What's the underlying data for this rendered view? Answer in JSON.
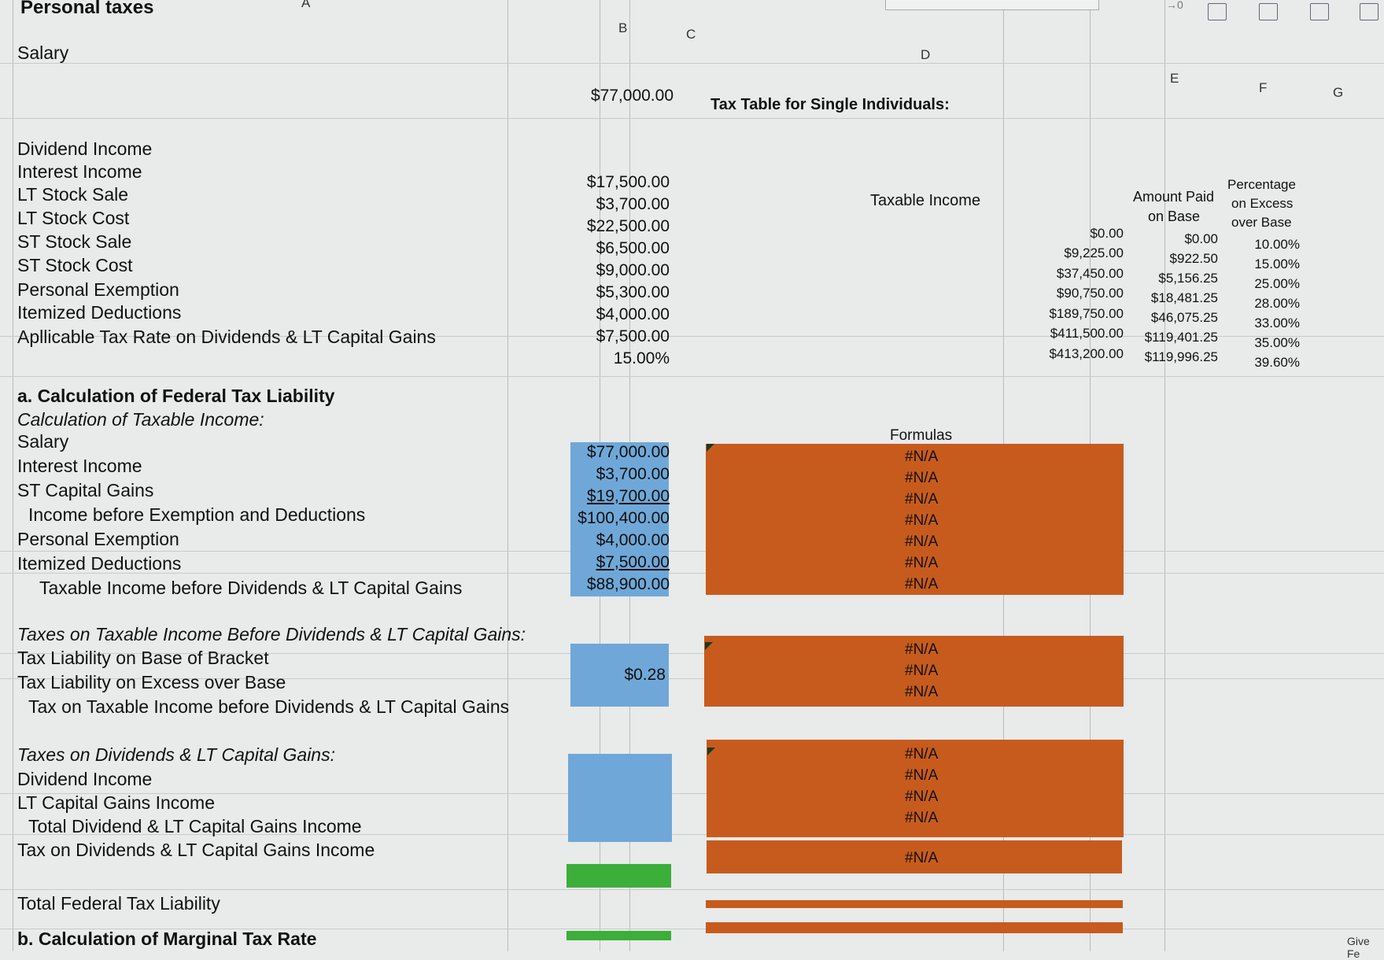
{
  "title": "Personal taxes",
  "column_headers": {
    "A": "A",
    "B": "B",
    "C": "C",
    "D": "D",
    "E": "E",
    "F": "F",
    "G": "G"
  },
  "inputs": [
    {
      "label": "Salary",
      "value": "$77,000.00"
    },
    {
      "label": "Dividend Income",
      "value": "$17,500.00"
    },
    {
      "label": "Interest Income",
      "value": "$3,700.00"
    },
    {
      "label": "LT Stock Sale",
      "value": "$22,500.00"
    },
    {
      "label": "LT Stock Cost",
      "value": "$6,500.00"
    },
    {
      "label": "ST Stock Sale",
      "value": "$9,000.00"
    },
    {
      "label": "ST Stock Cost",
      "value": "$5,300.00"
    },
    {
      "label": "Personal Exemption",
      "value": "$4,000.00"
    },
    {
      "label": "Itemized Deductions",
      "value": "$7,500.00"
    },
    {
      "label": "Apllicable Tax Rate on Dividends & LT Capital Gains",
      "value": "15.00%"
    }
  ],
  "tax_table": {
    "title": "Tax Table for Single Individuals:",
    "col_taxable": "Taxable Income",
    "col_amount_1": "Amount Paid",
    "col_amount_2": "on Base",
    "col_pct_1": "Percentage",
    "col_pct_2": "on Excess",
    "col_pct_3": "over Base",
    "rows": [
      {
        "income": "$0.00",
        "base": "$0.00",
        "pct": "10.00%"
      },
      {
        "income": "$9,225.00",
        "base": "$922.50",
        "pct": "15.00%"
      },
      {
        "income": "$37,450.00",
        "base": "$5,156.25",
        "pct": "25.00%"
      },
      {
        "income": "$90,750.00",
        "base": "$18,481.25",
        "pct": "28.00%"
      },
      {
        "income": "$189,750.00",
        "base": "$46,075.25",
        "pct": "33.00%"
      },
      {
        "income": "$411,500.00",
        "base": "$119,401.25",
        "pct": "35.00%"
      },
      {
        "income": "$413,200.00",
        "base": "$119,996.25",
        "pct": "39.60%"
      }
    ]
  },
  "section_a": {
    "heading": "a. Calculation of Federal Tax Liability",
    "subheading": "Calculation of Taxable Income:",
    "formulas_label": "Formulas",
    "rows": [
      {
        "label": "Salary",
        "value": "$77,000.00",
        "formula": "#N/A"
      },
      {
        "label": "Interest Income",
        "value": "$3,700.00",
        "formula": "#N/A"
      },
      {
        "label": "ST Capital Gains",
        "value": "$19,700.00",
        "formula": "#N/A"
      },
      {
        "label": "Income before Exemption and Deductions",
        "value": "$100,400.00",
        "formula": "#N/A"
      },
      {
        "label": "Personal Exemption",
        "value": "$4,000.00",
        "formula": "#N/A"
      },
      {
        "label": "Itemized Deductions",
        "value": "$7,500.00",
        "formula": "#N/A"
      },
      {
        "label": "Taxable Income before Dividends & LT Capital Gains",
        "value": "$88,900.00",
        "formula": "#N/A"
      }
    ]
  },
  "taxes_before": {
    "heading": "Taxes on Taxable Income Before Dividends & LT Capital Gains:",
    "rows": [
      {
        "label": "Tax Liability on Base of Bracket",
        "formula": "#N/A"
      },
      {
        "label": "Tax Liability on Excess over Base",
        "formula": "#N/A"
      },
      {
        "label": "Tax on Taxable Income before Dividends & LT Capital Gains",
        "formula": "#N/A"
      }
    ],
    "value": "$0.28"
  },
  "taxes_div": {
    "heading": "Taxes on Dividends & LT Capital Gains:",
    "rows": [
      {
        "label": "Dividend Income",
        "formula": "#N/A"
      },
      {
        "label": "LT Capital Gains Income",
        "formula": "#N/A"
      },
      {
        "label": "Total Dividend & LT Capital Gains Income",
        "formula": "#N/A"
      },
      {
        "label": "Tax on Dividends & LT Capital Gains Income",
        "formula": "#N/A"
      }
    ]
  },
  "total_row": {
    "label": "Total Federal Tax Liability",
    "formula": "#N/A"
  },
  "section_b": {
    "heading": "b. Calculation of Marginal Tax Rate"
  },
  "ribbon_snippet": "→0",
  "corner_text": "Give Fe",
  "colors": {
    "input_fill": "#6fa8d8",
    "formula_fill": "#c75b1d",
    "total_fill": "#3cae3a"
  }
}
